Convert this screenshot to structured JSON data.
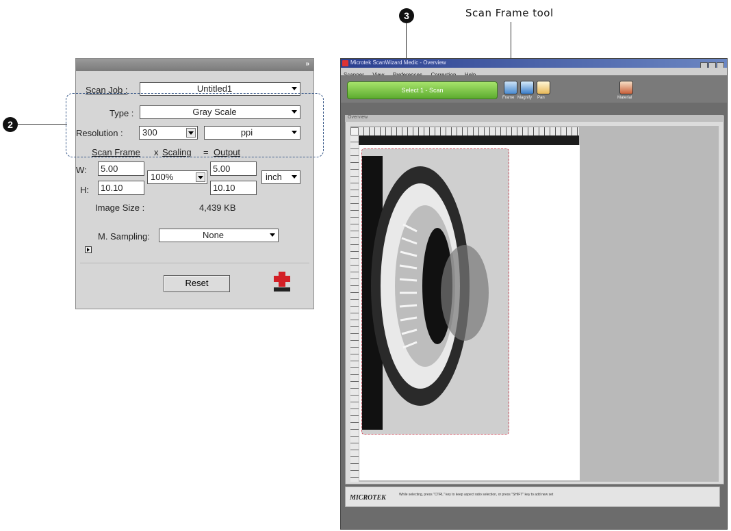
{
  "callouts": {
    "badge_2": "2",
    "badge_3": "3",
    "scan_frame_tool_label": "Scan Frame tool"
  },
  "settings_panel": {
    "scan_job_label": "Scan Job :",
    "scan_job_value": "Untitled1",
    "type_label": "Type :",
    "type_value": "Gray Scale",
    "resolution_label": "Resolution :",
    "resolution_value": "300",
    "resolution_unit": "ppi",
    "header_scan_frame": "Scan Frame",
    "header_x": "x",
    "header_scaling": "Scaling",
    "header_eq": "=",
    "header_output": "Output",
    "w_label": "W:",
    "h_label": "H:",
    "frame_w": "5.00",
    "frame_h": "10.10",
    "scaling_value": "100%",
    "output_w": "5.00",
    "output_h": "10.10",
    "unit_value": "inch",
    "image_size_label": "Image Size :",
    "image_size_value": "4,439 KB",
    "m_sampling_label": "M. Sampling:",
    "m_sampling_value": "None",
    "reset_label": "Reset"
  },
  "app_window": {
    "title": "Microtek ScanWizard Medic - Overview",
    "menu": [
      "Scanner",
      "View",
      "Preferences",
      "Correction",
      "Help"
    ],
    "select_scan_label": "Select 1 - Scan",
    "tools": [
      "Frame",
      "Magnify",
      "Pan"
    ],
    "extra_tool_label": "Material",
    "preview_title": "Overview",
    "logo_text": "MICROTEK",
    "status_text": "While selecting, press \"CTRL\" key to keep aspect ratio selection, or press \"SHIFT\" key to add new set"
  },
  "colors": {
    "accent_green": "#5cab2f",
    "callout_dash": "#3a5a8a",
    "frame_dash": "#cc4b5b"
  }
}
